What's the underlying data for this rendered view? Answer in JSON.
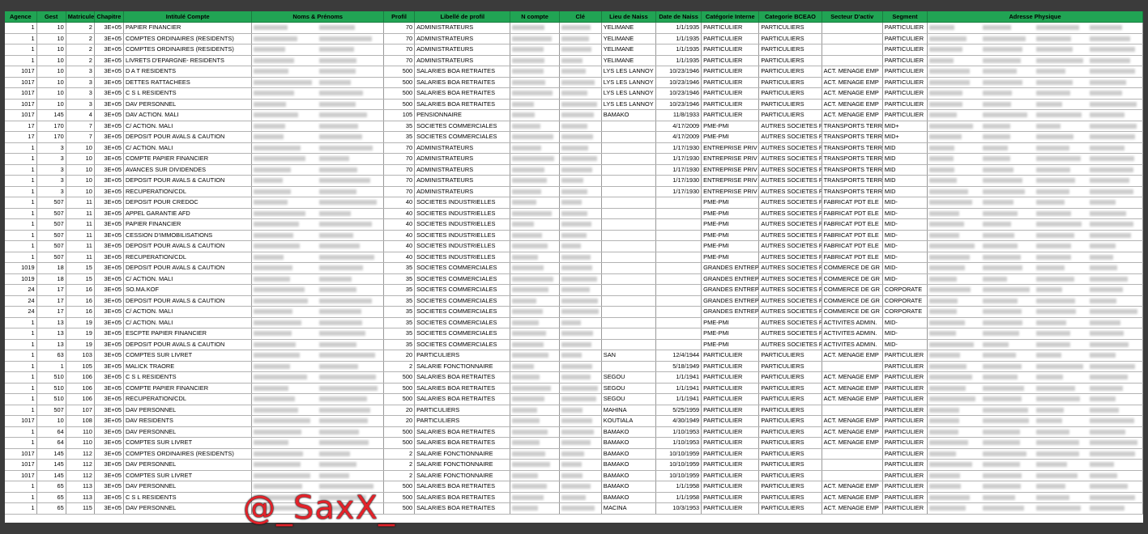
{
  "columns": [
    {
      "key": "agence",
      "label": "Agence",
      "w": 39,
      "align": "num"
    },
    {
      "key": "gest",
      "label": "Gest",
      "w": 36,
      "align": "num"
    },
    {
      "key": "matricule",
      "label": "Matricule",
      "w": 35,
      "align": "num"
    },
    {
      "key": "chapitre",
      "label": "Chapitre",
      "w": 36,
      "align": "num"
    },
    {
      "key": "intitule",
      "label": "Intitulé Compte",
      "w": 158,
      "align": "txt"
    },
    {
      "key": "noms",
      "label": "Noms & Prénoms",
      "w": 162,
      "align": "blur"
    },
    {
      "key": "profil",
      "label": "Profil",
      "w": 38,
      "align": "num"
    },
    {
      "key": "libelle",
      "label": "Libellé de profil",
      "w": 118,
      "align": "txt"
    },
    {
      "key": "ncompte",
      "label": "N compte",
      "w": 60,
      "align": "blur"
    },
    {
      "key": "cle",
      "label": "Clé",
      "w": 52,
      "align": "blur"
    },
    {
      "key": "lieu",
      "label": "Lieu de Naiss",
      "w": 67,
      "align": "txt"
    },
    {
      "key": "date",
      "label": "Date de Naiss",
      "w": 56,
      "align": "num"
    },
    {
      "key": "catint",
      "label": "Catégorie Interne",
      "w": 71,
      "align": "txt"
    },
    {
      "key": "catbceao",
      "label": "Categorie BCEAO",
      "w": 77,
      "align": "txt"
    },
    {
      "key": "secteur",
      "label": "Secteur D'activ",
      "w": 75,
      "align": "txt"
    },
    {
      "key": "segment",
      "label": "Segment",
      "w": 55,
      "align": "txt"
    },
    {
      "key": "adresse",
      "label": "Adresse Physique",
      "w": 265,
      "align": "blur"
    }
  ],
  "rows": [
    [
      "1",
      "10",
      "2",
      "3E+05",
      "PAPIER FINANCIER",
      "",
      "70",
      "ADMINISTRATEURS",
      "",
      "",
      "YELIMANE",
      "1/1/1935",
      "PARTICULIER",
      "PARTICULIERS",
      "",
      "PARTICULIER",
      ""
    ],
    [
      "1",
      "10",
      "2",
      "3E+05",
      "COMPTES ORDINAIRES (RESIDENTS)",
      "",
      "70",
      "ADMINISTRATEURS",
      "",
      "",
      "YELIMANE",
      "1/1/1935",
      "PARTICULIER",
      "PARTICULIERS",
      "",
      "PARTICULIER",
      ""
    ],
    [
      "1",
      "10",
      "2",
      "3E+05",
      "COMPTES ORDINAIRES (RESIDENTS)",
      "",
      "70",
      "ADMINISTRATEURS",
      "",
      "",
      "YELIMANE",
      "1/1/1935",
      "PARTICULIER",
      "PARTICULIERS",
      "",
      "PARTICULIER",
      ""
    ],
    [
      "1",
      "10",
      "2",
      "3E+05",
      "LIVRETS D'EPARGNE- RESIDENTS",
      "",
      "70",
      "ADMINISTRATEURS",
      "",
      "",
      "YELIMANE",
      "1/1/1935",
      "PARTICULIER",
      "PARTICULIERS",
      "",
      "PARTICULIER",
      ""
    ],
    [
      "1017",
      "10",
      "3",
      "3E+05",
      "D A T RESIDENTS",
      "",
      "500",
      "SALARIES BOA RETRAITES",
      "",
      "",
      "LYS LES LANNOY",
      "10/23/1946",
      "PARTICULIER",
      "PARTICULIERS",
      "ACT. MENAGE EMP",
      "PARTICULIER",
      ""
    ],
    [
      "1017",
      "10",
      "3",
      "3E+05",
      "DETTES RATTACHEES",
      "",
      "500",
      "SALARIES BOA RETRAITES",
      "",
      "",
      "LYS LES LANNOY",
      "10/23/1946",
      "PARTICULIER",
      "PARTICULIERS",
      "ACT. MENAGE EMP",
      "PARTICULIER",
      ""
    ],
    [
      "1017",
      "10",
      "3",
      "3E+05",
      "C S L RESIDENTS",
      "",
      "500",
      "SALARIES BOA RETRAITES",
      "",
      "",
      "LYS LES LANNOY",
      "10/23/1946",
      "PARTICULIER",
      "PARTICULIERS",
      "ACT. MENAGE EMP",
      "PARTICULIER",
      ""
    ],
    [
      "1017",
      "10",
      "3",
      "3E+05",
      "DAV PERSONNEL",
      "",
      "500",
      "SALARIES BOA RETRAITES",
      "",
      "",
      "LYS LES LANNOY",
      "10/23/1946",
      "PARTICULIER",
      "PARTICULIERS",
      "ACT. MENAGE EMP",
      "PARTICULIER",
      ""
    ],
    [
      "1017",
      "145",
      "4",
      "3E+05",
      "DAV ACTION. MALI",
      "",
      "105",
      "PENSIONNAIRE",
      "",
      "",
      "BAMAKO",
      "11/8/1933",
      "PARTICULIER",
      "PARTICULIERS",
      "ACT. MENAGE EMP",
      "PARTICULIER",
      ""
    ],
    [
      "17",
      "170",
      "7",
      "3E+05",
      "C/ ACTION. MALI",
      "",
      "35",
      "SOCIETES COMMERCIALES",
      "",
      "",
      "",
      "4/17/2009",
      "PME-PMI",
      "AUTRES SOCIETES P",
      "TRANSPORTS TERR",
      "MID+",
      ""
    ],
    [
      "17",
      "170",
      "7",
      "3E+05",
      "DEPOSIT POUR AVALS & CAUTION",
      "",
      "35",
      "SOCIETES COMMERCIALES",
      "",
      "",
      "",
      "4/17/2009",
      "PME-PMI",
      "AUTRES SOCIETES P",
      "TRANSPORTS TERR",
      "MID+",
      ""
    ],
    [
      "1",
      "3",
      "10",
      "3E+05",
      "C/ ACTION. MALI",
      "",
      "70",
      "ADMINISTRATEURS",
      "",
      "",
      "",
      "1/17/1930",
      "ENTREPRISE PRIV",
      "AUTRES SOCIETES P",
      "TRANSPORTS TERR",
      "MID",
      ""
    ],
    [
      "1",
      "3",
      "10",
      "3E+05",
      "COMPTE PAPIER FINANCIER",
      "",
      "70",
      "ADMINISTRATEURS",
      "",
      "",
      "",
      "1/17/1930",
      "ENTREPRISE PRIV",
      "AUTRES SOCIETES P",
      "TRANSPORTS TERR",
      "MID",
      ""
    ],
    [
      "1",
      "3",
      "10",
      "3E+05",
      "AVANCES SUR DIVIDENDES",
      "",
      "70",
      "ADMINISTRATEURS",
      "",
      "",
      "",
      "1/17/1930",
      "ENTREPRISE PRIV",
      "AUTRES SOCIETES P",
      "TRANSPORTS TERR",
      "MID",
      ""
    ],
    [
      "1",
      "3",
      "10",
      "3E+05",
      "DEPOSIT POUR AVALS & CAUTION",
      "",
      "70",
      "ADMINISTRATEURS",
      "",
      "",
      "",
      "1/17/1930",
      "ENTREPRISE PRIV",
      "AUTRES SOCIETES P",
      "TRANSPORTS TERR",
      "MID",
      ""
    ],
    [
      "1",
      "3",
      "10",
      "3E+05",
      "RECUPERATION/CDL",
      "",
      "70",
      "ADMINISTRATEURS",
      "",
      "",
      "",
      "1/17/1930",
      "ENTREPRISE PRIV",
      "AUTRES SOCIETES P",
      "TRANSPORTS TERR",
      "MID",
      ""
    ],
    [
      "1",
      "507",
      "11",
      "3E+05",
      "DEPOSIT POUR CREDOC",
      "",
      "40",
      "SOCIETES INDUSTRIELLES",
      "",
      "",
      "",
      "",
      "PME-PMI",
      "AUTRES SOCIETES P",
      "FABRICAT PDT ELE",
      "MID-",
      ""
    ],
    [
      "1",
      "507",
      "11",
      "3E+05",
      "APPEL GARANTIE AFD",
      "",
      "40",
      "SOCIETES INDUSTRIELLES",
      "",
      "",
      "",
      "",
      "PME-PMI",
      "AUTRES SOCIETES P",
      "FABRICAT PDT ELE",
      "MID-",
      ""
    ],
    [
      "1",
      "507",
      "11",
      "3E+05",
      "PAPIER FINANCIER",
      "",
      "40",
      "SOCIETES INDUSTRIELLES",
      "",
      "",
      "",
      "",
      "PME-PMI",
      "AUTRES SOCIETES P",
      "FABRICAT PDT ELE",
      "MID-",
      ""
    ],
    [
      "1",
      "507",
      "11",
      "3E+05",
      "CESSION D'IMMOBILISATIONS",
      "",
      "40",
      "SOCIETES INDUSTRIELLES",
      "",
      "",
      "",
      "",
      "PME-PMI",
      "AUTRES SOCIETES P",
      "FABRICAT PDT ELE",
      "MID-",
      ""
    ],
    [
      "1",
      "507",
      "11",
      "3E+05",
      "DEPOSIT POUR AVALS & CAUTION",
      "",
      "40",
      "SOCIETES INDUSTRIELLES",
      "",
      "",
      "",
      "",
      "PME-PMI",
      "AUTRES SOCIETES P",
      "FABRICAT PDT ELE",
      "MID-",
      ""
    ],
    [
      "1",
      "507",
      "11",
      "3E+05",
      "RECUPERATION/CDL",
      "",
      "40",
      "SOCIETES INDUSTRIELLES",
      "",
      "",
      "",
      "",
      "PME-PMI",
      "AUTRES SOCIETES P",
      "FABRICAT PDT ELE",
      "MID-",
      ""
    ],
    [
      "1019",
      "18",
      "15",
      "3E+05",
      "DEPOSIT POUR AVALS & CAUTION",
      "",
      "35",
      "SOCIETES COMMERCIALES",
      "",
      "",
      "",
      "",
      "GRANDES ENTREP",
      "AUTRES SOCIETES P",
      "COMMERCE DE GR",
      "MID-",
      ""
    ],
    [
      "1019",
      "18",
      "15",
      "3E+05",
      "C/ ACTION. MALI",
      "",
      "35",
      "SOCIETES COMMERCIALES",
      "",
      "",
      "",
      "",
      "GRANDES ENTREP",
      "AUTRES SOCIETES P",
      "COMMERCE DE GR",
      "MID-",
      ""
    ],
    [
      "24",
      "17",
      "16",
      "3E+05",
      "SO.MA.KOF",
      "",
      "35",
      "SOCIETES COMMERCIALES",
      "",
      "",
      "",
      "",
      "GRANDES ENTREP",
      "AUTRES SOCIETES P",
      "COMMERCE DE GR",
      "CORPORATE",
      ""
    ],
    [
      "24",
      "17",
      "16",
      "3E+05",
      "DEPOSIT POUR AVALS & CAUTION",
      "",
      "35",
      "SOCIETES COMMERCIALES",
      "",
      "",
      "",
      "",
      "GRANDES ENTREP",
      "AUTRES SOCIETES P",
      "COMMERCE DE GR",
      "CORPORATE",
      ""
    ],
    [
      "24",
      "17",
      "16",
      "3E+05",
      "C/ ACTION. MALI",
      "",
      "35",
      "SOCIETES COMMERCIALES",
      "",
      "",
      "",
      "",
      "GRANDES ENTREP",
      "AUTRES SOCIETES P",
      "COMMERCE DE GR",
      "CORPORATE",
      ""
    ],
    [
      "1",
      "13",
      "19",
      "3E+05",
      "C/ ACTION. MALI",
      "",
      "35",
      "SOCIETES COMMERCIALES",
      "",
      "",
      "",
      "",
      "PME-PMI",
      "AUTRES SOCIETES P",
      "ACTIVITES ADMIN.",
      "MID-",
      ""
    ],
    [
      "1",
      "13",
      "19",
      "3E+05",
      "ESCPTE PAPIER FINANCIER",
      "",
      "35",
      "SOCIETES COMMERCIALES",
      "",
      "",
      "",
      "",
      "PME-PMI",
      "AUTRES SOCIETES P",
      "ACTIVITES ADMIN.",
      "MID-",
      ""
    ],
    [
      "1",
      "13",
      "19",
      "3E+05",
      "DEPOSIT POUR AVALS & CAUTION",
      "",
      "35",
      "SOCIETES COMMERCIALES",
      "",
      "",
      "",
      "",
      "PME-PMI",
      "AUTRES SOCIETES P",
      "ACTIVITES ADMIN.",
      "MID-",
      ""
    ],
    [
      "1",
      "63",
      "103",
      "3E+05",
      "COMPTES SUR LIVRET",
      "",
      "20",
      "PARTICULIERS",
      "",
      "",
      "SAN",
      "12/4/1944",
      "PARTICULIER",
      "PARTICULIERS",
      "ACT. MENAGE EMP",
      "PARTICULIER",
      ""
    ],
    [
      "1",
      "1",
      "105",
      "3E+05",
      "MALICK TRAORE",
      "",
      "2",
      "SALARIE FONCTIONNAIRE",
      "",
      "",
      "",
      "5/18/1949",
      "PARTICULIER",
      "PARTICULIERS",
      "",
      "PARTICULIER",
      ""
    ],
    [
      "1",
      "510",
      "106",
      "3E+05",
      "C S L RESIDENTS",
      "",
      "500",
      "SALARIES BOA RETRAITES",
      "",
      "",
      "SEGOU",
      "1/1/1941",
      "PARTICULIER",
      "PARTICULIERS",
      "ACT. MENAGE EMP",
      "PARTICULIER",
      ""
    ],
    [
      "1",
      "510",
      "106",
      "3E+05",
      "COMPTE PAPIER FINANCIER",
      "",
      "500",
      "SALARIES BOA RETRAITES",
      "",
      "",
      "SEGOU",
      "1/1/1941",
      "PARTICULIER",
      "PARTICULIERS",
      "ACT. MENAGE EMP",
      "PARTICULIER",
      ""
    ],
    [
      "1",
      "510",
      "106",
      "3E+05",
      "RECUPERATION/CDL",
      "",
      "500",
      "SALARIES BOA RETRAITES",
      "",
      "",
      "SEGOU",
      "1/1/1941",
      "PARTICULIER",
      "PARTICULIERS",
      "ACT. MENAGE EMP",
      "PARTICULIER",
      ""
    ],
    [
      "1",
      "507",
      "107",
      "3E+05",
      "DAV PERSONNEL",
      "",
      "20",
      "PARTICULIERS",
      "",
      "",
      "MAHINA",
      "5/25/1959",
      "PARTICULIER",
      "PARTICULIERS",
      "",
      "PARTICULIER",
      ""
    ],
    [
      "1017",
      "10",
      "108",
      "3E+05",
      "DAV RESIDENTS",
      "",
      "20",
      "PARTICULIERS",
      "",
      "",
      "KOUTIALA",
      "4/30/1949",
      "PARTICULIER",
      "PARTICULIERS",
      "ACT. MENAGE EMP",
      "PARTICULIER",
      ""
    ],
    [
      "1",
      "64",
      "110",
      "3E+05",
      "DAV PERSONNEL",
      "",
      "500",
      "SALARIES BOA RETRAITES",
      "",
      "",
      "BAMAKO",
      "1/10/1953",
      "PARTICULIER",
      "PARTICULIERS",
      "ACT. MENAGE EMP",
      "PARTICULIER",
      ""
    ],
    [
      "1",
      "64",
      "110",
      "3E+05",
      "COMPTES SUR LIVRET",
      "",
      "500",
      "SALARIES BOA RETRAITES",
      "",
      "",
      "BAMAKO",
      "1/10/1953",
      "PARTICULIER",
      "PARTICULIERS",
      "ACT. MENAGE EMP",
      "PARTICULIER",
      ""
    ],
    [
      "1017",
      "145",
      "112",
      "3E+05",
      "COMPTES ORDINAIRES (RESIDENTS)",
      "",
      "2",
      "SALARIE FONCTIONNAIRE",
      "",
      "",
      "BAMAKO",
      "10/10/1959",
      "PARTICULIER",
      "PARTICULIERS",
      "",
      "PARTICULIER",
      ""
    ],
    [
      "1017",
      "145",
      "112",
      "3E+05",
      "DAV PERSONNEL",
      "",
      "2",
      "SALARIE FONCTIONNAIRE",
      "",
      "",
      "BAMAKO",
      "10/10/1959",
      "PARTICULIER",
      "PARTICULIERS",
      "",
      "PARTICULIER",
      ""
    ],
    [
      "1017",
      "145",
      "112",
      "3E+05",
      "COMPTES SUR LIVRET",
      "",
      "2",
      "SALARIE FONCTIONNAIRE",
      "",
      "",
      "BAMAKO",
      "10/10/1959",
      "PARTICULIER",
      "PARTICULIERS",
      "",
      "PARTICULIER",
      ""
    ],
    [
      "1",
      "65",
      "113",
      "3E+05",
      "DAV PERSONNEL",
      "",
      "500",
      "SALARIES BOA RETRAITES",
      "",
      "",
      "BAMAKO",
      "1/1/1958",
      "PARTICULIER",
      "PARTICULIERS",
      "ACT. MENAGE EMP",
      "PARTICULIER",
      ""
    ],
    [
      "1",
      "65",
      "113",
      "3E+05",
      "C S L RESIDENTS",
      "",
      "500",
      "SALARIES BOA RETRAITES",
      "",
      "",
      "BAMAKO",
      "1/1/1958",
      "PARTICULIER",
      "PARTICULIERS",
      "ACT. MENAGE EMP",
      "PARTICULIER",
      ""
    ],
    [
      "1",
      "65",
      "115",
      "3E+05",
      "DAV PERSONNEL",
      "",
      "500",
      "SALARIES BOA RETRAITES",
      "",
      "",
      "MACINA",
      "10/3/1953",
      "PARTICULIER",
      "PARTICULIERS",
      "ACT. MENAGE EMP",
      "PARTICULIER",
      ""
    ]
  ],
  "watermark": "@_SaxX_",
  "colors": {
    "header_bg": "#21a454",
    "background": "#3b3b3b",
    "watermark": "#e3222a"
  }
}
